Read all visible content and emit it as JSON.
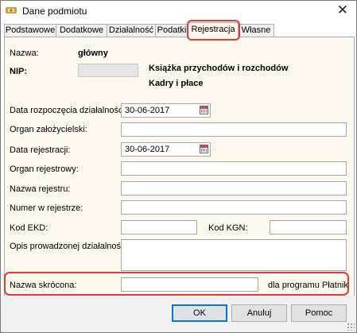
{
  "window": {
    "title": "Dane podmiotu",
    "close_symbol": "✕"
  },
  "tabs": [
    {
      "label": "Podstawowe"
    },
    {
      "label": "Dodatkowe"
    },
    {
      "label": "Działalność"
    },
    {
      "label": "Podatki"
    },
    {
      "label": "Rejestracja",
      "active": true
    },
    {
      "label": "Własne"
    }
  ],
  "form": {
    "nazwa_label": "Nazwa:",
    "nazwa_value": "główny",
    "nip_label": "NIP:",
    "nip_value": "",
    "ksiega_text": "Książka przychodów i rozchodów",
    "kadry_text": "Kadry i płace",
    "data_rozpoczecia_label": "Data rozpoczęcia działalności:",
    "data_rozpoczecia_value": "30-06-2017",
    "organ_zalozycielski_label": "Organ założycielski:",
    "organ_zalozycielski_value": "",
    "data_rejestracji_label": "Data rejestracji:",
    "data_rejestracji_value": "30-06-2017",
    "organ_rejestrowy_label": "Organ rejestrowy:",
    "organ_rejestrowy_value": "",
    "nazwa_rejestru_label": "Nazwa rejestru:",
    "nazwa_rejestru_value": "",
    "numer_rejestru_label": "Numer w rejestrze:",
    "numer_rejestru_value": "",
    "kod_ekd_label": "Kod EKD:",
    "kod_ekd_value": "",
    "kod_kgn_label": "Kod KGN:",
    "kod_kgn_value": "",
    "opis_label": "Opis prowadzonej działalności:",
    "opis_value": "",
    "nazwa_skrocona_label": "Nazwa skrócona:",
    "nazwa_skrocona_value": "",
    "platnik_text": "dla programu Płatnik"
  },
  "buttons": {
    "ok": "OK",
    "cancel": "Anuluj",
    "help": "Pomoc"
  },
  "colors": {
    "highlight": "#e53935",
    "panel_bg": "#fdf8ee",
    "default_button_border": "#0078d7"
  }
}
